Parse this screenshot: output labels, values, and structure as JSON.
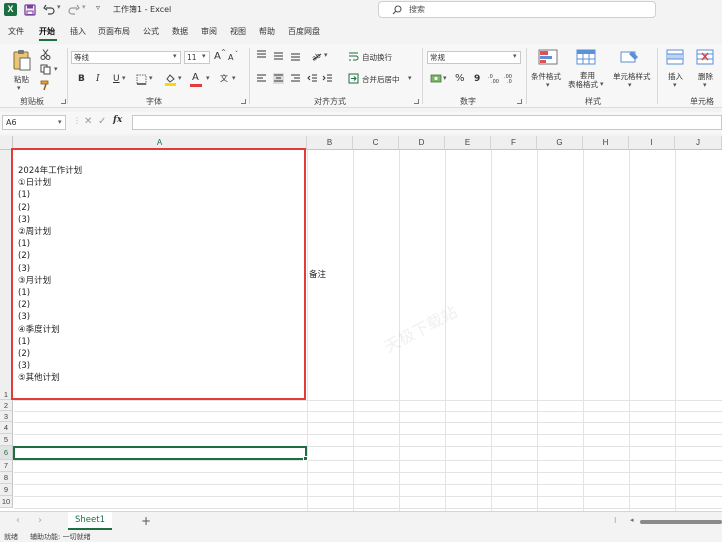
{
  "titlebar": {
    "app_letter": "X",
    "title": "工作簿1 - Excel",
    "search_placeholder": "搜索"
  },
  "ribbon_tabs": [
    "文件",
    "开始",
    "插入",
    "页面布局",
    "公式",
    "数据",
    "审阅",
    "视图",
    "帮助",
    "百度网盘"
  ],
  "active_tab": "开始",
  "ribbon": {
    "clipboard": {
      "paste_label": "粘贴",
      "group_label": "剪贴板"
    },
    "font": {
      "font_name": "等线",
      "font_size": "11",
      "group_label": "字体",
      "bold": "B",
      "italic": "I",
      "underline": "U",
      "grow": "A",
      "shrink": "A",
      "font_color_glyph": "A"
    },
    "alignment": {
      "wrap_text": "自动换行",
      "merge_center": "合并后居中",
      "group_label": "对齐方式"
    },
    "number": {
      "format": "常规",
      "percent": "%",
      "comma": "9",
      "group_label": "数字"
    },
    "styles": {
      "conditional": "条件格式",
      "table_format_1": "套用",
      "table_format_2": "表格格式",
      "cell_styles": "单元格样式",
      "group_label": "样式"
    },
    "cells": {
      "insert": "插入",
      "delete": "删除",
      "group_label": "单元格"
    }
  },
  "formula_bar": {
    "name_box": "A6",
    "fx": "fx",
    "value": ""
  },
  "grid": {
    "columns": [
      "A",
      "B",
      "C",
      "D",
      "E",
      "F",
      "G",
      "H",
      "I",
      "J"
    ],
    "rows": [
      "1",
      "2",
      "3",
      "4",
      "5",
      "6",
      "7",
      "8",
      "9",
      "10"
    ],
    "a1_text": "2024年工作计划\n①日计划\n(1)\n(2)\n(3)\n②周计划\n(1)\n(2)\n(3)\n③月计划\n(1)\n(2)\n(3)\n④季度计划\n(1)\n(2)\n(3)\n⑤其他计划",
    "b1_text": "备注",
    "watermark": "天极下载站"
  },
  "sheet_tabs": [
    "Sheet1"
  ],
  "statusbar": {
    "ready": "就绪",
    "accessibility": "辅助功能: 一切就绪"
  },
  "colors": {
    "excel_green": "#1d6f42",
    "highlight_red": "#e03c3c",
    "selection_green": "#1d6f42"
  }
}
